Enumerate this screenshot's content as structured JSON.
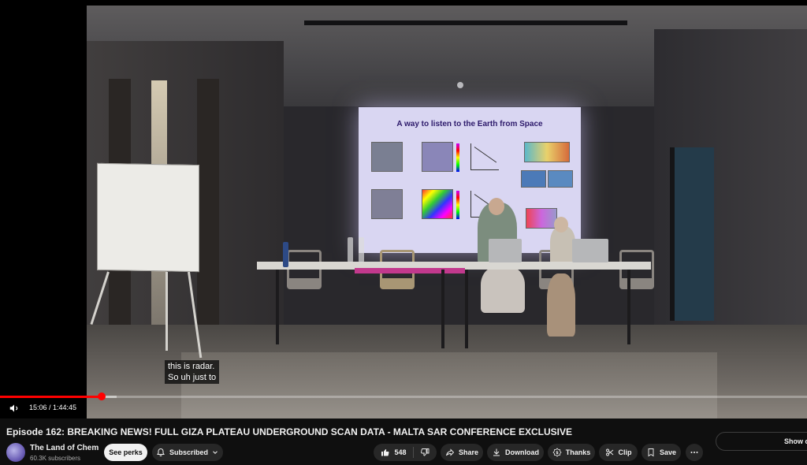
{
  "player": {
    "slide_title": "A way to listen to the Earth from Space",
    "captions": [
      "this is radar.",
      "So uh just to"
    ],
    "time_display": "15:06 / 1:44:45",
    "progress_fraction": 0.126,
    "buffer_fraction": 0.145
  },
  "video": {
    "title": "Episode 162: BREAKING NEWS! FULL GIZA PLATEAU UNDERGROUND SCAN DATA - MALTA SAR CONFERENCE EXCLUSIVE"
  },
  "channel": {
    "name": "The Land of Chem",
    "subscribers": "60.3K subscribers",
    "see_perks_label": "See perks",
    "subscribed_label": "Subscribed"
  },
  "actions": {
    "like_count": "548",
    "share_label": "Share",
    "download_label": "Download",
    "thanks_label": "Thanks",
    "clip_label": "Clip",
    "save_label": "Save"
  },
  "chat": {
    "show_label": "Show c"
  },
  "icons": [
    "volume-icon",
    "bell-icon",
    "chevron-down-icon",
    "thumbs-up-icon",
    "thumbs-down-icon",
    "share-icon",
    "download-icon",
    "thanks-icon",
    "clip-icon",
    "save-icon",
    "more-icon"
  ],
  "colors": {
    "accent": "#ff0000",
    "background": "#0f0f0f",
    "pill": "#272727"
  }
}
